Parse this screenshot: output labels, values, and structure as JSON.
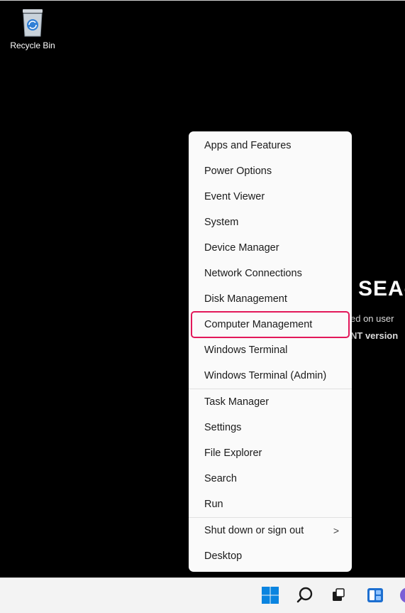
{
  "desktop": {
    "background_color": "#000000",
    "recycle_bin": {
      "label": "Recycle Bin",
      "icon": "recycle-bin-icon"
    },
    "wallpaper": {
      "title": "SEA-",
      "line1": "ed on user",
      "line2": "NT version"
    }
  },
  "context_menu": {
    "highlight_color": "#e2185a",
    "groups": [
      {
        "items": [
          {
            "label": "Apps and Features"
          },
          {
            "label": "Power Options"
          },
          {
            "label": "Event Viewer"
          },
          {
            "label": "System"
          },
          {
            "label": "Device Manager"
          },
          {
            "label": "Network Connections"
          },
          {
            "label": "Disk Management"
          },
          {
            "label": "Computer Management",
            "highlighted": true
          },
          {
            "label": "Windows Terminal"
          },
          {
            "label": "Windows Terminal (Admin)"
          }
        ]
      },
      {
        "items": [
          {
            "label": "Task Manager"
          },
          {
            "label": "Settings"
          },
          {
            "label": "File Explorer"
          },
          {
            "label": "Search"
          },
          {
            "label": "Run"
          }
        ]
      },
      {
        "items": [
          {
            "label": "Shut down or sign out",
            "submenu": true,
            "chevron": ">"
          },
          {
            "label": "Desktop"
          }
        ]
      }
    ]
  },
  "taskbar": {
    "icons": [
      "windows-start-icon",
      "search-icon",
      "task-view-icon",
      "widgets-icon",
      "chat-icon"
    ]
  }
}
